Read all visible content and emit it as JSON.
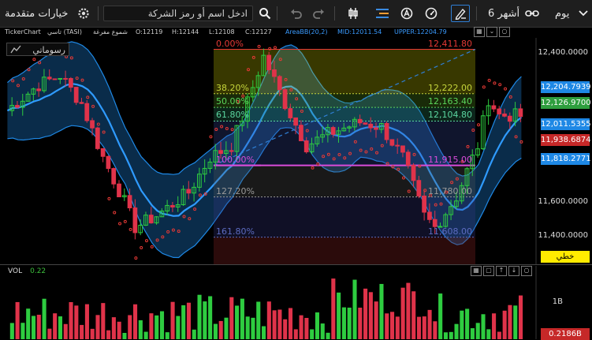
{
  "toolbar": {
    "settings_label": "خيارات متقدمة",
    "search_placeholder": "ادخل اسم أو رمز الشركة",
    "period_label": "6 أشهر",
    "interval_label": "يوم"
  },
  "chart_info": {
    "name": "TickerChart",
    "symbol": "تاسي (TASI)",
    "candle_type": "شموع مفرغة",
    "open": "O:12119",
    "high": "H:12144",
    "low": "L:12108",
    "close": "C:12127",
    "bb_name": "AreaBB(20,2)",
    "bb_mid": "MID:12011.54",
    "bb_upper": "UPPER:12204.79"
  },
  "drawings_tag": "رسوماتي",
  "price_axis": {
    "ticks": [
      "12,400.0000",
      "11,600.0000",
      "11,400.0000"
    ],
    "badges": [
      {
        "value": "12,204.7939",
        "color": "#1e88e5"
      },
      {
        "value": "12,126.9700",
        "color": "#2e9e3e"
      },
      {
        "value": "12,011.5355",
        "color": "#1e88e5"
      },
      {
        "value": "11,938.6874",
        "color": "#c62828"
      },
      {
        "value": "11,818.2771",
        "color": "#1e88e5"
      }
    ],
    "scale_button": "خطي"
  },
  "fibonacci": {
    "levels": [
      {
        "pct": "0.00%",
        "price": "12,411.80",
        "color": "#e53935"
      },
      {
        "pct": "38.20%",
        "price": "12,222.00",
        "color": "#c6d63c"
      },
      {
        "pct": "50.00%",
        "price": "12,163.40",
        "color": "#5bd65b"
      },
      {
        "pct": "61.80%",
        "price": "12,104.80",
        "color": "#5bd6a0"
      },
      {
        "pct": "100.00%",
        "price": "11,915.00",
        "color": "#d94bd9"
      },
      {
        "pct": "127.20%",
        "price": "11,780.00",
        "color": "#9a9a9a"
      },
      {
        "pct": "161.80%",
        "price": "11,608.00",
        "color": "#5c6bc0"
      }
    ]
  },
  "volume": {
    "label": "VOL",
    "value": "0.22",
    "tick": "1B",
    "badge": "0.2186B"
  },
  "colors": {
    "up": "#2ecc40",
    "down": "#e0334a",
    "band": "#1e88e5",
    "sar": "#e53935"
  }
}
